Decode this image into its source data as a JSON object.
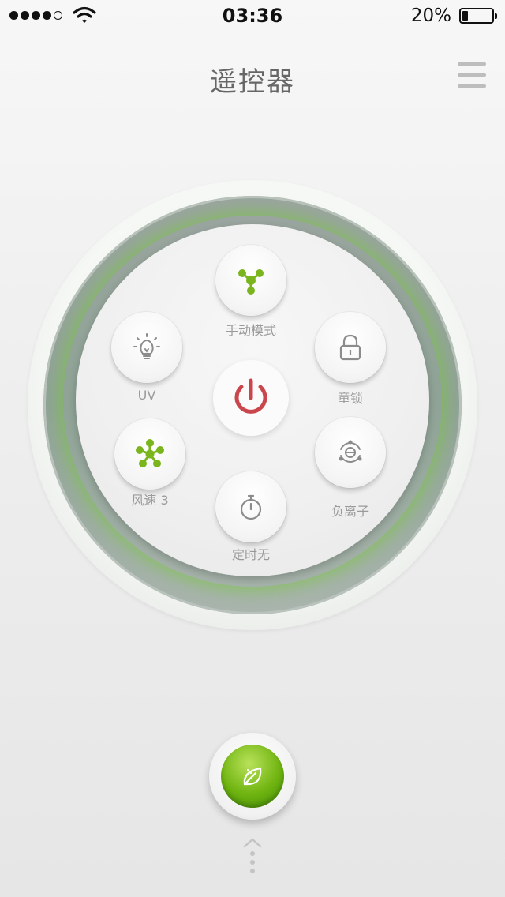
{
  "status_bar": {
    "time": "03:36",
    "battery_percent_text": "20%",
    "battery_level": 0.2,
    "signal_bars_filled": 4,
    "signal_bars_total": 5,
    "wifi_icon": "wifi-icon"
  },
  "header": {
    "title": "遥控器",
    "menu_icon": "menu-icon"
  },
  "controls": {
    "mode": {
      "label": "手动模式",
      "icon": "molecule-icon",
      "color": "#7ab51d"
    },
    "uv": {
      "label": "UV",
      "icon": "lightbulb-icon"
    },
    "child_lock": {
      "label": "童锁",
      "icon": "lock-icon"
    },
    "fan_speed": {
      "label": "风速 3",
      "icon": "fan-icon",
      "color": "#7ab51d"
    },
    "anion": {
      "label": "负离子",
      "icon": "anion-icon"
    },
    "timer": {
      "label": "定时无",
      "icon": "stopwatch-icon"
    },
    "power": {
      "icon": "power-icon",
      "color": "#c8464c"
    }
  },
  "bottom": {
    "leaf_icon": "leaf-icon",
    "accent": "#6fb410",
    "pull_up_icon": "chevron-up-icon"
  }
}
